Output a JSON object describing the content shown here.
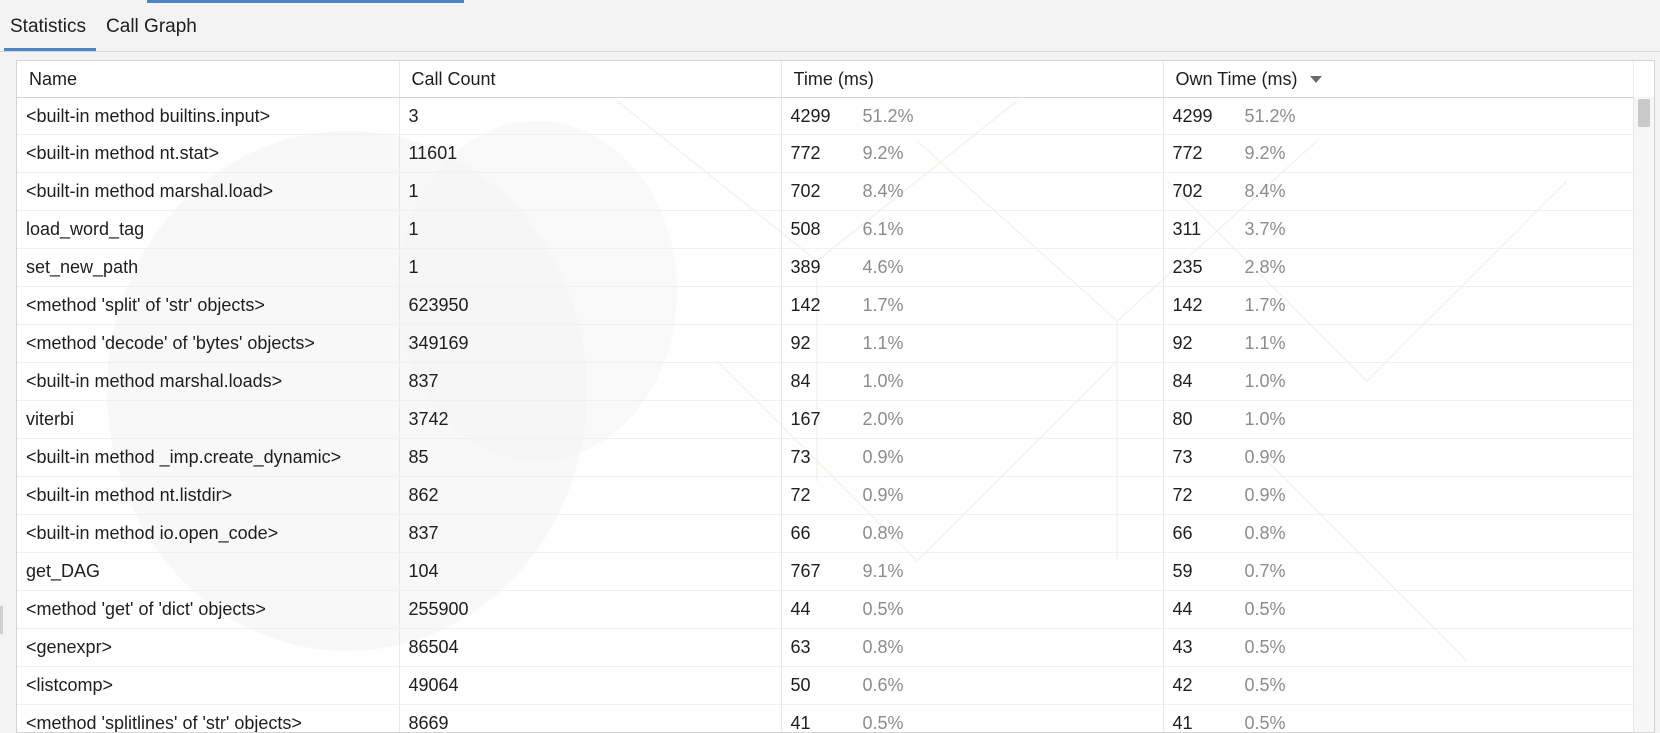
{
  "tabs": [
    {
      "label": "Statistics",
      "active": true
    },
    {
      "label": "Call Graph",
      "active": false
    }
  ],
  "columns": [
    "Name",
    "Call Count",
    "Time (ms)",
    "Own Time (ms)"
  ],
  "sorted_column": "Own Time (ms)",
  "rows": [
    {
      "name": "<built-in method builtins.input>",
      "calls": "3",
      "time": "4299",
      "time_pct": "51.2%",
      "own": "4299",
      "own_pct": "51.2%"
    },
    {
      "name": "<built-in method nt.stat>",
      "calls": "11601",
      "time": "772",
      "time_pct": "9.2%",
      "own": "772",
      "own_pct": "9.2%"
    },
    {
      "name": "<built-in method marshal.load>",
      "calls": "1",
      "time": "702",
      "time_pct": "8.4%",
      "own": "702",
      "own_pct": "8.4%"
    },
    {
      "name": "load_word_tag",
      "calls": "1",
      "time": "508",
      "time_pct": "6.1%",
      "own": "311",
      "own_pct": "3.7%"
    },
    {
      "name": "set_new_path",
      "calls": "1",
      "time": "389",
      "time_pct": "4.6%",
      "own": "235",
      "own_pct": "2.8%"
    },
    {
      "name": "<method 'split' of 'str' objects>",
      "calls": "623950",
      "time": "142",
      "time_pct": "1.7%",
      "own": "142",
      "own_pct": "1.7%"
    },
    {
      "name": "<method 'decode' of 'bytes' objects>",
      "calls": "349169",
      "time": "92",
      "time_pct": "1.1%",
      "own": "92",
      "own_pct": "1.1%"
    },
    {
      "name": "<built-in method marshal.loads>",
      "calls": "837",
      "time": "84",
      "time_pct": "1.0%",
      "own": "84",
      "own_pct": "1.0%"
    },
    {
      "name": "viterbi",
      "calls": "3742",
      "time": "167",
      "time_pct": "2.0%",
      "own": "80",
      "own_pct": "1.0%"
    },
    {
      "name": "<built-in method _imp.create_dynamic>",
      "calls": "85",
      "time": "73",
      "time_pct": "0.9%",
      "own": "73",
      "own_pct": "0.9%"
    },
    {
      "name": "<built-in method nt.listdir>",
      "calls": "862",
      "time": "72",
      "time_pct": "0.9%",
      "own": "72",
      "own_pct": "0.9%"
    },
    {
      "name": "<built-in method io.open_code>",
      "calls": "837",
      "time": "66",
      "time_pct": "0.8%",
      "own": "66",
      "own_pct": "0.8%"
    },
    {
      "name": "get_DAG",
      "calls": "104",
      "time": "767",
      "time_pct": "9.1%",
      "own": "59",
      "own_pct": "0.7%"
    },
    {
      "name": "<method 'get' of 'dict' objects>",
      "calls": "255900",
      "time": "44",
      "time_pct": "0.5%",
      "own": "44",
      "own_pct": "0.5%"
    },
    {
      "name": "<genexpr>",
      "calls": "86504",
      "time": "63",
      "time_pct": "0.8%",
      "own": "43",
      "own_pct": "0.5%"
    },
    {
      "name": "<listcomp>",
      "calls": "49064",
      "time": "50",
      "time_pct": "0.6%",
      "own": "42",
      "own_pct": "0.5%"
    },
    {
      "name": "<method 'splitlines' of 'str' objects>",
      "calls": "8669",
      "time": "41",
      "time_pct": "0.5%",
      "own": "41",
      "own_pct": "0.5%"
    }
  ],
  "colors": {
    "accent": "#4a86c8",
    "pct_text": "#8c8c8c"
  },
  "icons": {
    "sort": "sort-descending-icon"
  }
}
